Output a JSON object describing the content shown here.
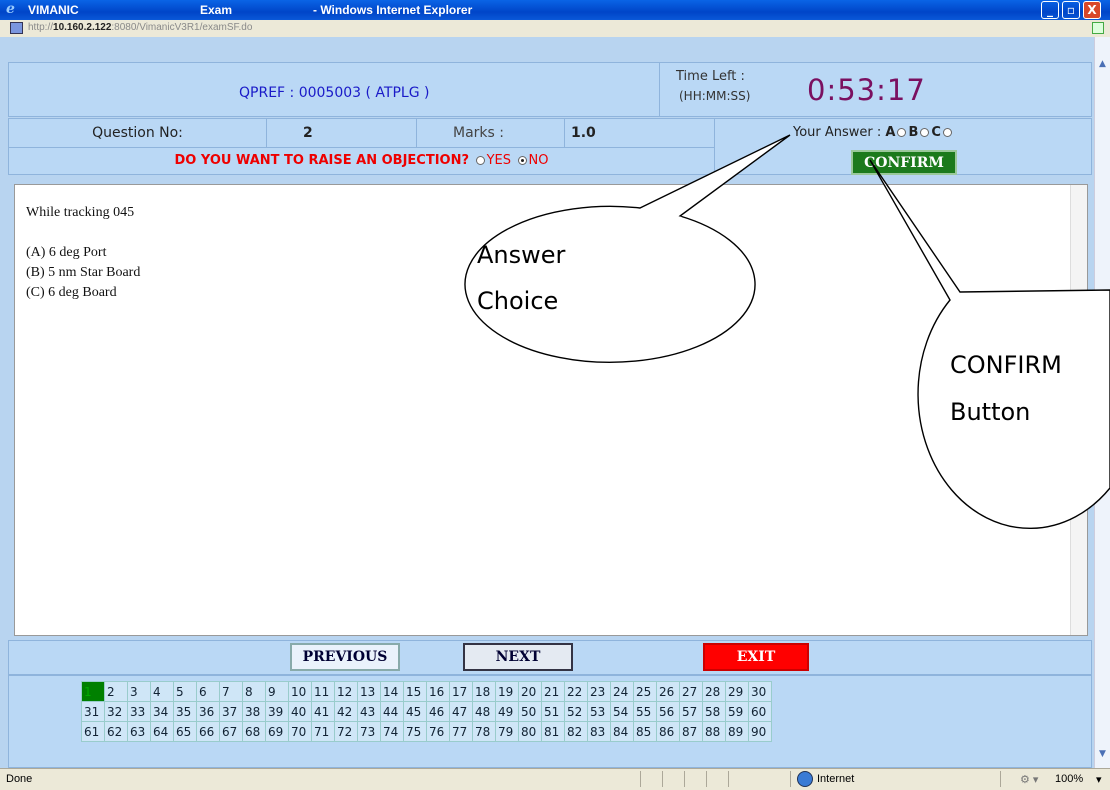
{
  "window": {
    "app": "VIMANIC",
    "section": "Exam",
    "browser": "- Windows Internet Explorer",
    "url_prefix": "http://",
    "url_host": "10.160.2.122",
    "url_rest": ":8080/VimanicV3R1/examSF.do",
    "minimize": "_",
    "restore": "▫",
    "close": "X"
  },
  "header": {
    "qpref": "QPREF : 0005003 ( ATPLG )",
    "time_left_label": "Time Left :",
    "time_format": "(HH:MM:SS)",
    "timer": "0:53:17"
  },
  "question_row": {
    "question_no_label": "Question No:",
    "question_no": "2",
    "marks_label": "Marks :",
    "marks": "1.0",
    "your_answer_label": "Your Answer :",
    "options": [
      "A",
      "B",
      "C"
    ],
    "selected": null
  },
  "objection": {
    "prompt": "DO YOU WANT TO RAISE AN OBJECTION?",
    "yes": "YES",
    "no": "NO",
    "selected": "NO"
  },
  "confirm_label": "CONFIRM",
  "question": {
    "text": "While tracking 045",
    "choices": [
      "(A)  6 deg Port",
      "(B)  5 nm Star Board",
      "(C)  6 deg Board"
    ]
  },
  "nav": {
    "previous": "PREVIOUS",
    "next": "NEXT",
    "exit": "EXIT"
  },
  "question_grid": {
    "current": 1,
    "rows": [
      [
        "1",
        "2",
        "3",
        "4",
        "5",
        "6",
        "7",
        "8",
        "9",
        "10",
        "11",
        "12",
        "13",
        "14",
        "15",
        "16",
        "17",
        "18",
        "19",
        "20",
        "21",
        "22",
        "23",
        "24",
        "25",
        "26",
        "27",
        "28",
        "29",
        "30"
      ],
      [
        "31",
        "32",
        "33",
        "34",
        "35",
        "36",
        "37",
        "38",
        "39",
        "40",
        "41",
        "42",
        "43",
        "44",
        "45",
        "46",
        "47",
        "48",
        "49",
        "50",
        "51",
        "52",
        "53",
        "54",
        "55",
        "56",
        "57",
        "58",
        "59",
        "60"
      ],
      [
        "61",
        "62",
        "63",
        "64",
        "65",
        "66",
        "67",
        "68",
        "69",
        "70",
        "71",
        "72",
        "73",
        "74",
        "75",
        "76",
        "77",
        "78",
        "79",
        "80",
        "81",
        "82",
        "83",
        "84",
        "85",
        "86",
        "87",
        "88",
        "89",
        "90"
      ]
    ]
  },
  "callouts": {
    "answer_line1": "Answer",
    "answer_line2": "Choice",
    "confirm_line1": "CONFIRM",
    "confirm_line2": "Button"
  },
  "statusbar": {
    "status": "Done",
    "zone": "Internet",
    "zoom": "100%"
  },
  "colors": {
    "timer": "#7a1060",
    "qpref": "#1a1ac8",
    "objection": "#e00000",
    "confirm": "#1c7a1c",
    "exit": "#ff0000",
    "current_question": "#008000"
  }
}
